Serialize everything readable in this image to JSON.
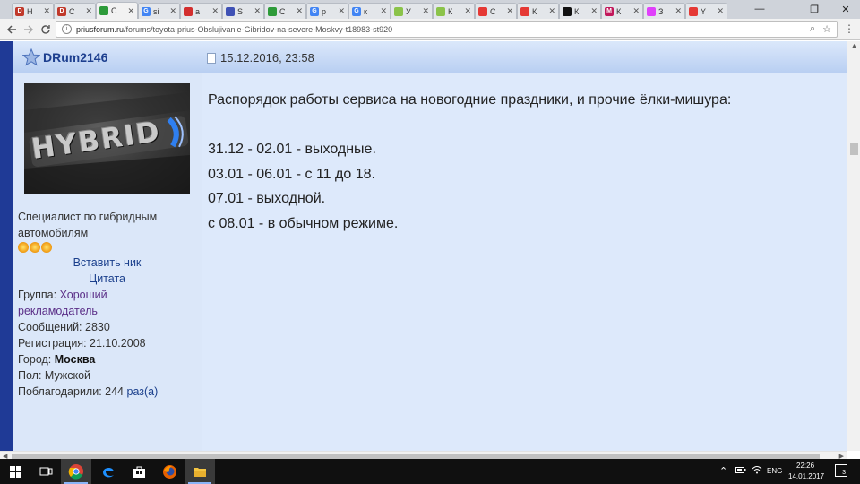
{
  "browser": {
    "tabs": [
      {
        "icon": "drive2-icon",
        "color": "#c0392b",
        "glyph": "D",
        "label": "H"
      },
      {
        "icon": "drive2-icon",
        "color": "#c0392b",
        "glyph": "D",
        "label": "C"
      },
      {
        "icon": "priusforum-icon",
        "color": "#2e9b3a",
        "glyph": "",
        "label": "C"
      },
      {
        "icon": "google-icon",
        "color": "#4285f4",
        "glyph": "G",
        "label": "si"
      },
      {
        "icon": "mitsubishi-icon",
        "color": "#d32f2f",
        "glyph": "",
        "label": "a"
      },
      {
        "icon": "cube-icon",
        "color": "#3f51b5",
        "glyph": "",
        "label": "S"
      },
      {
        "icon": "priusforum-icon",
        "color": "#2e9b3a",
        "glyph": "",
        "label": "C"
      },
      {
        "icon": "google-icon",
        "color": "#4285f4",
        "glyph": "G",
        "label": "p"
      },
      {
        "icon": "google-icon",
        "color": "#4285f4",
        "glyph": "G",
        "label": "к"
      },
      {
        "icon": "map-icon",
        "color": "#8bc34a",
        "glyph": "",
        "label": "У"
      },
      {
        "icon": "map-icon",
        "color": "#8bc34a",
        "glyph": "",
        "label": "К"
      },
      {
        "icon": "flag-icon",
        "color": "#e53935",
        "glyph": "",
        "label": "С"
      },
      {
        "icon": "heart-icon",
        "color": "#e53935",
        "glyph": "",
        "label": "К"
      },
      {
        "icon": "black-square-icon",
        "color": "#111111",
        "glyph": "",
        "label": "К"
      },
      {
        "icon": "m-logo-icon",
        "color": "#c2185b",
        "glyph": "M",
        "label": "К"
      },
      {
        "icon": "pink-circle-icon",
        "color": "#e040fb",
        "glyph": "",
        "label": "З"
      },
      {
        "icon": "youtube-icon",
        "color": "#e53935",
        "glyph": "",
        "label": "Y"
      }
    ],
    "url_host": "priusforum.ru",
    "url_path": "/forums/toyota-prius-Obslujivanie-Gibridov-na-severe-Moskvy-t18983-st920",
    "min_glyph": "—",
    "max_glyph": "❐",
    "close_glyph": "✕"
  },
  "post": {
    "author": {
      "nick": "DRum2146",
      "title": [
        "Специалист по гибридным",
        "автомобилям"
      ],
      "rank_stars": 3,
      "insert_nick": "Вставить ник",
      "quote": "Цитата",
      "group_label": "Группа:",
      "group_value": [
        "Хороший",
        "рекламодатель"
      ],
      "messages_label": "Сообщений:",
      "messages_value": "2830",
      "registered_label": "Регистрация:",
      "registered_value": "21.10.2008",
      "city_label": "Город:",
      "city_value": "Москва",
      "gender_label": "Пол:",
      "gender_value": "Мужской",
      "thanked_label": "Поблагодарили:",
      "thanked_value": "244",
      "thanked_link": "раз(а)",
      "avatar_text": "HYBRID"
    },
    "date": "15.12.2016, 23:58",
    "lines": [
      "Распорядок работы сервиса на новогодние праздники, и прочие ёлки-мишура:",
      "",
      "31.12 - 02.01 - выходные.",
      "03.01 - 06.01 - с 11 до 18.",
      "07.01 - выходной.",
      "с 08.01 - в обычном режиме."
    ]
  },
  "taskbar": {
    "lang": "ENG",
    "time": "22:26",
    "date": "14.01.2017",
    "notifications": "3"
  },
  "colors": {
    "left_border": "#1f3a96",
    "post_bg": "#dde9fb",
    "nick": "#1d3f8f",
    "link": "#5b2f88"
  }
}
